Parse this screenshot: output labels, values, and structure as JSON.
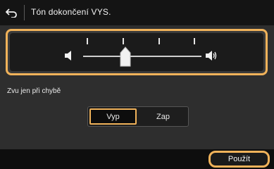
{
  "header": {
    "title": "Tón dokončení VYS."
  },
  "slider": {
    "level_index": 1,
    "level_count": 4
  },
  "option": {
    "label": "Zvu jen při chybě",
    "choices": [
      "Vyp",
      "Zap"
    ],
    "selected": "Vyp"
  },
  "footer": {
    "apply_label": "Použít"
  },
  "colors": {
    "accent": "#f0b25a",
    "panel": "#1b1b1b",
    "background": "#2e2e2e"
  }
}
